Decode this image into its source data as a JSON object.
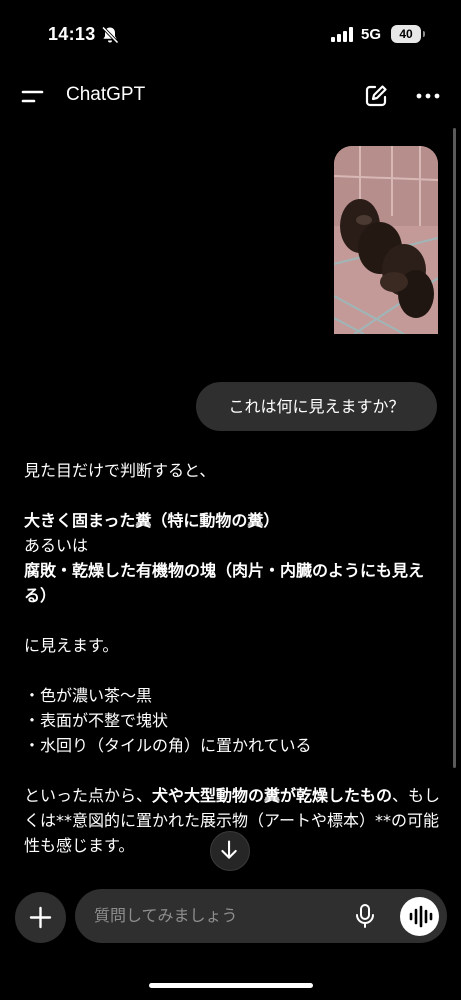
{
  "status_bar": {
    "time": "14:13",
    "network": "5G",
    "battery": "40"
  },
  "header": {
    "title": "ChatGPT"
  },
  "conversation": {
    "user_message": "これは何に見えますか？",
    "assistant": {
      "intro": "見た目だけで判断すると、",
      "guess1": "大きく固まった糞（特に動物の糞）",
      "or": "あるいは",
      "guess2": "腐敗・乾燥した有機物の塊（肉片・内臓のようにも見える）",
      "seems": "に見えます。",
      "bullets": [
        "・色が濃い茶〜黒",
        "・表面が不整で塊状",
        "・水回り（タイルの角）に置かれている"
      ],
      "conclusion_pre": "といった点から、",
      "conclusion_bold": "犬や大型動物の糞が乾燥したもの",
      "conclusion_post": "、もしくは**意図的に置かれた展示物（アートや標本）**の可能性も感じます。"
    }
  },
  "composer": {
    "placeholder": "質問してみましょう"
  }
}
